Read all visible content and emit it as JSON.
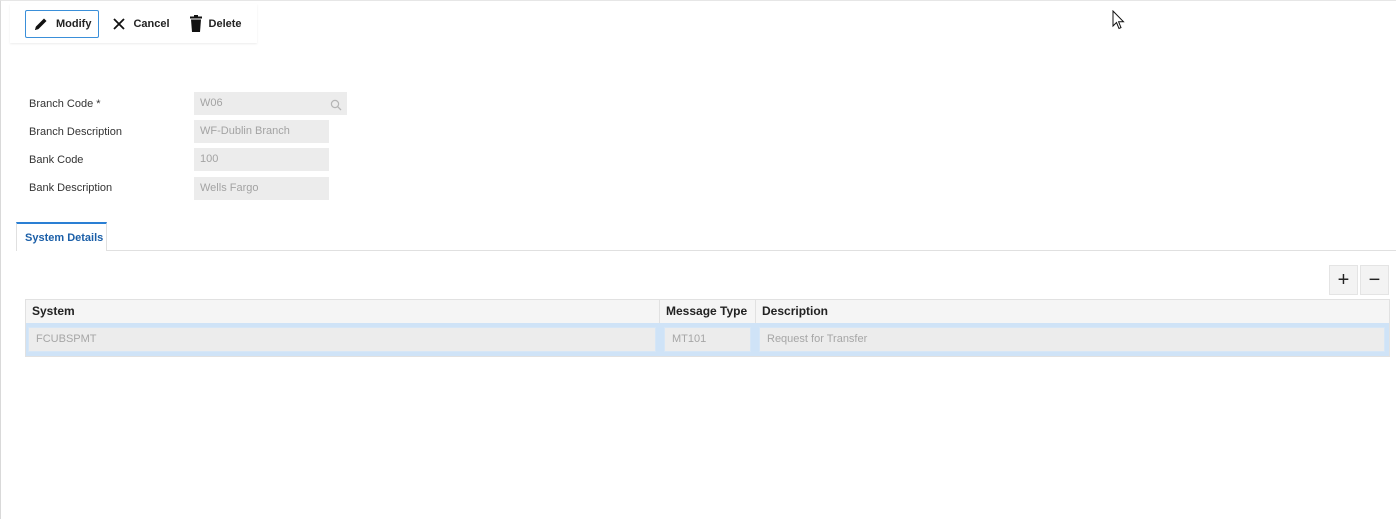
{
  "toolbar": {
    "modify_label": "Modify",
    "cancel_label": "Cancel",
    "delete_label": "Delete"
  },
  "form": {
    "branch_code": {
      "label": "Branch Code *",
      "value": "W06"
    },
    "branch_description": {
      "label": "Branch Description",
      "value": "WF-Dublin Branch"
    },
    "bank_code": {
      "label": "Bank Code",
      "value": "100"
    },
    "bank_description": {
      "label": "Bank Description",
      "value": "Wells Fargo"
    }
  },
  "tabs": [
    {
      "label": "System Details",
      "active": true
    }
  ],
  "grid": {
    "add_label": "+",
    "remove_label": "−",
    "columns": [
      "System",
      "Message Type",
      "Description"
    ],
    "rows": [
      [
        "FCUBSPMT",
        "MT101",
        "Request for Transfer"
      ]
    ]
  },
  "icons": {
    "modify": "pencil-icon",
    "cancel": "close-icon",
    "delete": "trash-icon",
    "search": "search-icon",
    "cursor": "mouse-cursor-icon"
  },
  "colors": {
    "accent": "#2a7fd4",
    "primary_border": "#3a8fd9",
    "input_bg": "#ececec",
    "row_selected": "#cfe3f7"
  }
}
